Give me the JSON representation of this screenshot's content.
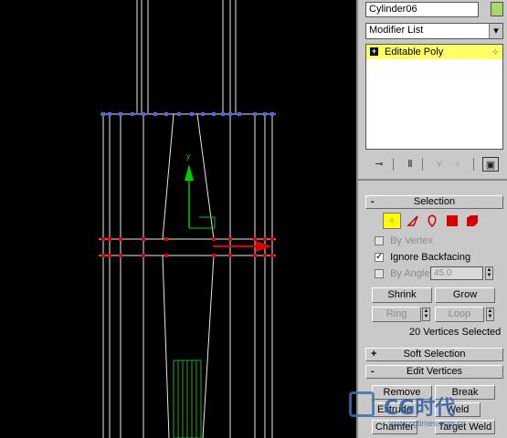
{
  "object_name": "Cylinder06",
  "object_color": "#a8d86a",
  "modifier_list": {
    "label": "Modifier List",
    "arrow": "▾"
  },
  "stack": {
    "items": [
      {
        "label": "Editable Poly",
        "expand": "+",
        "sub_icon": "vertex-dots-icon"
      }
    ],
    "highlight": "#ffff66"
  },
  "stack_toolbar": {
    "icons": [
      "pin-stack-icon",
      "show-end-result-icon",
      "make-unique-icon",
      "remove-modifier-icon",
      "configure-sets-icon"
    ]
  },
  "selection": {
    "title": "Selection",
    "collapse": "-",
    "levels": [
      "vertex-icon",
      "edge-icon",
      "border-icon",
      "polygon-icon",
      "element-icon"
    ],
    "by_vertex": "By Vertex",
    "ignore_backfacing": "Ignore Backfacing",
    "by_angle": "By Angle:",
    "angle_value": "45.0",
    "shrink": "Shrink",
    "grow": "Grow",
    "ring": "Ring",
    "loop": "Loop",
    "status": "20 Vertices Selected"
  },
  "soft_selection": {
    "title": "Soft Selection",
    "expand": "+"
  },
  "edit_vertices": {
    "title": "Edit Vertices",
    "collapse": "-",
    "remove": "Remove",
    "break": "Break",
    "extrude": "Extrude",
    "weld": "Weld",
    "chamfer": "Chamfer",
    "target_weld": "Target Weld"
  },
  "watermark": {
    "text": "CG时代",
    "url": "www.cgtimes.com.cn"
  },
  "viewport": {
    "axis_y": "y",
    "wire_color": "#ffffff",
    "vertex_color": "#dd0000",
    "top_vertex_color": "#4466ff",
    "gizmo_y_color": "#00cc00",
    "gizmo_x_color": "#dd0000"
  }
}
